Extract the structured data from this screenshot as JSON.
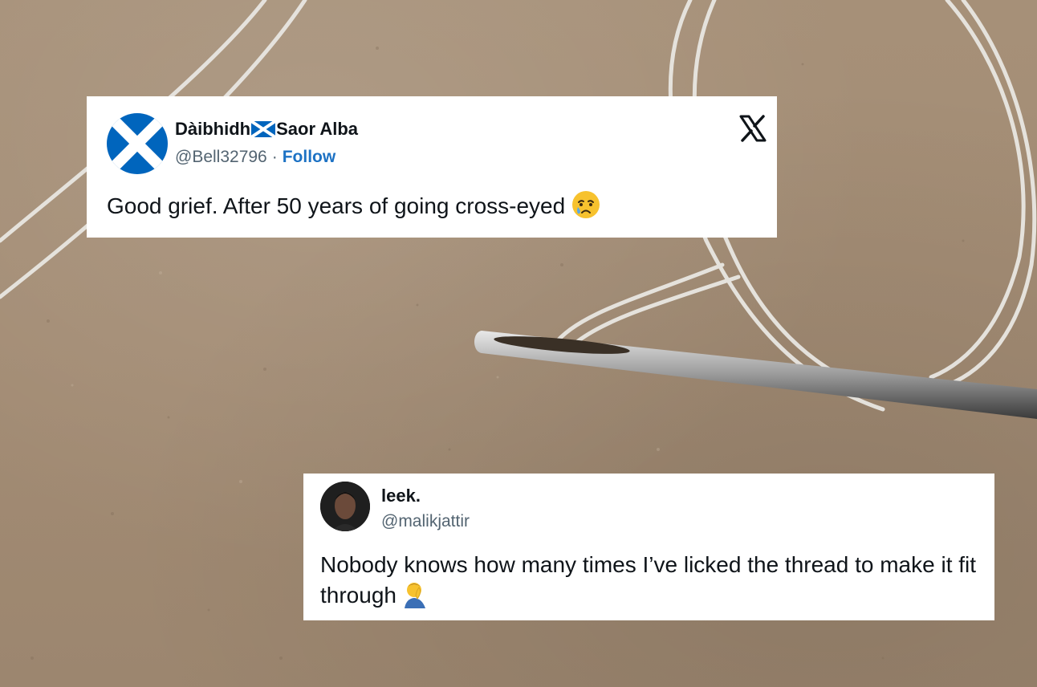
{
  "tweets": [
    {
      "display_name_part1": "Dàibhidh",
      "display_name_part2": "Saor Alba",
      "handle": "@Bell32796",
      "separator": "·",
      "follow_label": "Follow",
      "text": "Good grief. After 50 years of going cross-eyed",
      "emoji": "crying-face-emoji",
      "avatar": "scottish-saltire-flag",
      "platform_icon": "x-logo-icon"
    },
    {
      "display_name": "leek.",
      "handle": "@malikjattir",
      "text": "Nobody knows how many times I’ve licked the thread to make it fit through",
      "emoji": "man-facepalming-emoji",
      "avatar": "profile-photo"
    }
  ],
  "colors": {
    "card_bg": "#ffffff",
    "text": "#0f1419",
    "handle": "#536471",
    "follow": "#1d72c4",
    "saltire_blue": "#0065bd"
  }
}
